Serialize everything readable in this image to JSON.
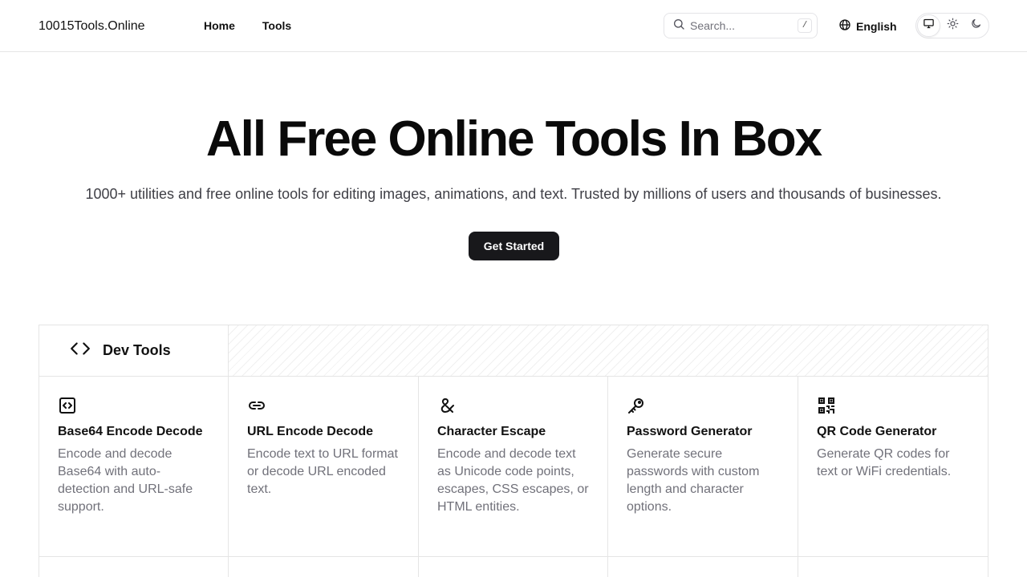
{
  "header": {
    "brand": "10015Tools.Online",
    "nav": [
      "Home",
      "Tools"
    ],
    "search": {
      "placeholder": "Search...",
      "shortcut": "/"
    },
    "language": "English",
    "theme_options": [
      {
        "name": "system",
        "icon": "monitor-icon",
        "active": true
      },
      {
        "name": "light",
        "icon": "sun-icon",
        "active": false
      },
      {
        "name": "dark",
        "icon": "moon-icon",
        "active": false
      }
    ]
  },
  "hero": {
    "title": "All Free Online Tools In Box",
    "subtitle": "1000+ utilities and free online tools for editing images, animations, and text. Trusted by millions of users and thousands of businesses.",
    "cta": "Get Started"
  },
  "category": {
    "name": "Dev Tools",
    "icon": "code-icon",
    "tools": [
      {
        "icon": "code-square-icon",
        "title": "Base64 Encode Decode",
        "description": "Encode and decode Base64 with auto-detection and URL-safe support."
      },
      {
        "icon": "link-icon",
        "title": "URL Encode Decode",
        "description": "Encode text to URL format or decode URL encoded text."
      },
      {
        "icon": "ampersand-icon",
        "title": "Character Escape",
        "description": "Encode and decode text as Unicode code points, escapes, CSS escapes, or HTML entities."
      },
      {
        "icon": "key-icon",
        "title": "Password Generator",
        "description": "Generate secure passwords with custom length and character options."
      },
      {
        "icon": "qr-code-icon",
        "title": "QR Code Generator",
        "description": "Generate QR codes for text or WiFi credentials."
      }
    ]
  }
}
